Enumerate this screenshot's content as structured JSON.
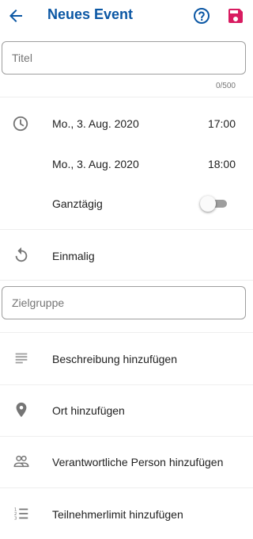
{
  "appbar": {
    "title": "Neues Event",
    "back_icon": "arrow-left-icon",
    "help_icon": "help-circle-icon",
    "save_icon": "save-icon",
    "accent_color": "#0b57a4",
    "save_color": "#d81b60"
  },
  "title_field": {
    "placeholder": "Titel",
    "value": "",
    "counter": "0/500"
  },
  "datetime": {
    "start_date": "Mo., 3. Aug. 2020",
    "start_time": "17:00",
    "end_date": "Mo., 3. Aug. 2020",
    "end_time": "18:00",
    "allday_label": "Ganztägig",
    "allday_on": false
  },
  "recurrence": {
    "label": "Einmalig"
  },
  "audience_field": {
    "placeholder": "Zielgruppe",
    "value": ""
  },
  "options": [
    {
      "label": "Beschreibung hinzufügen",
      "icon": "notes-icon"
    },
    {
      "label": "Ort hinzufügen",
      "icon": "location-pin-icon"
    },
    {
      "label": "Verantwortliche Person hinzufügen",
      "icon": "people-icon"
    },
    {
      "label": "Teilnehmerlimit hinzufügen",
      "icon": "numbered-list-icon"
    }
  ]
}
